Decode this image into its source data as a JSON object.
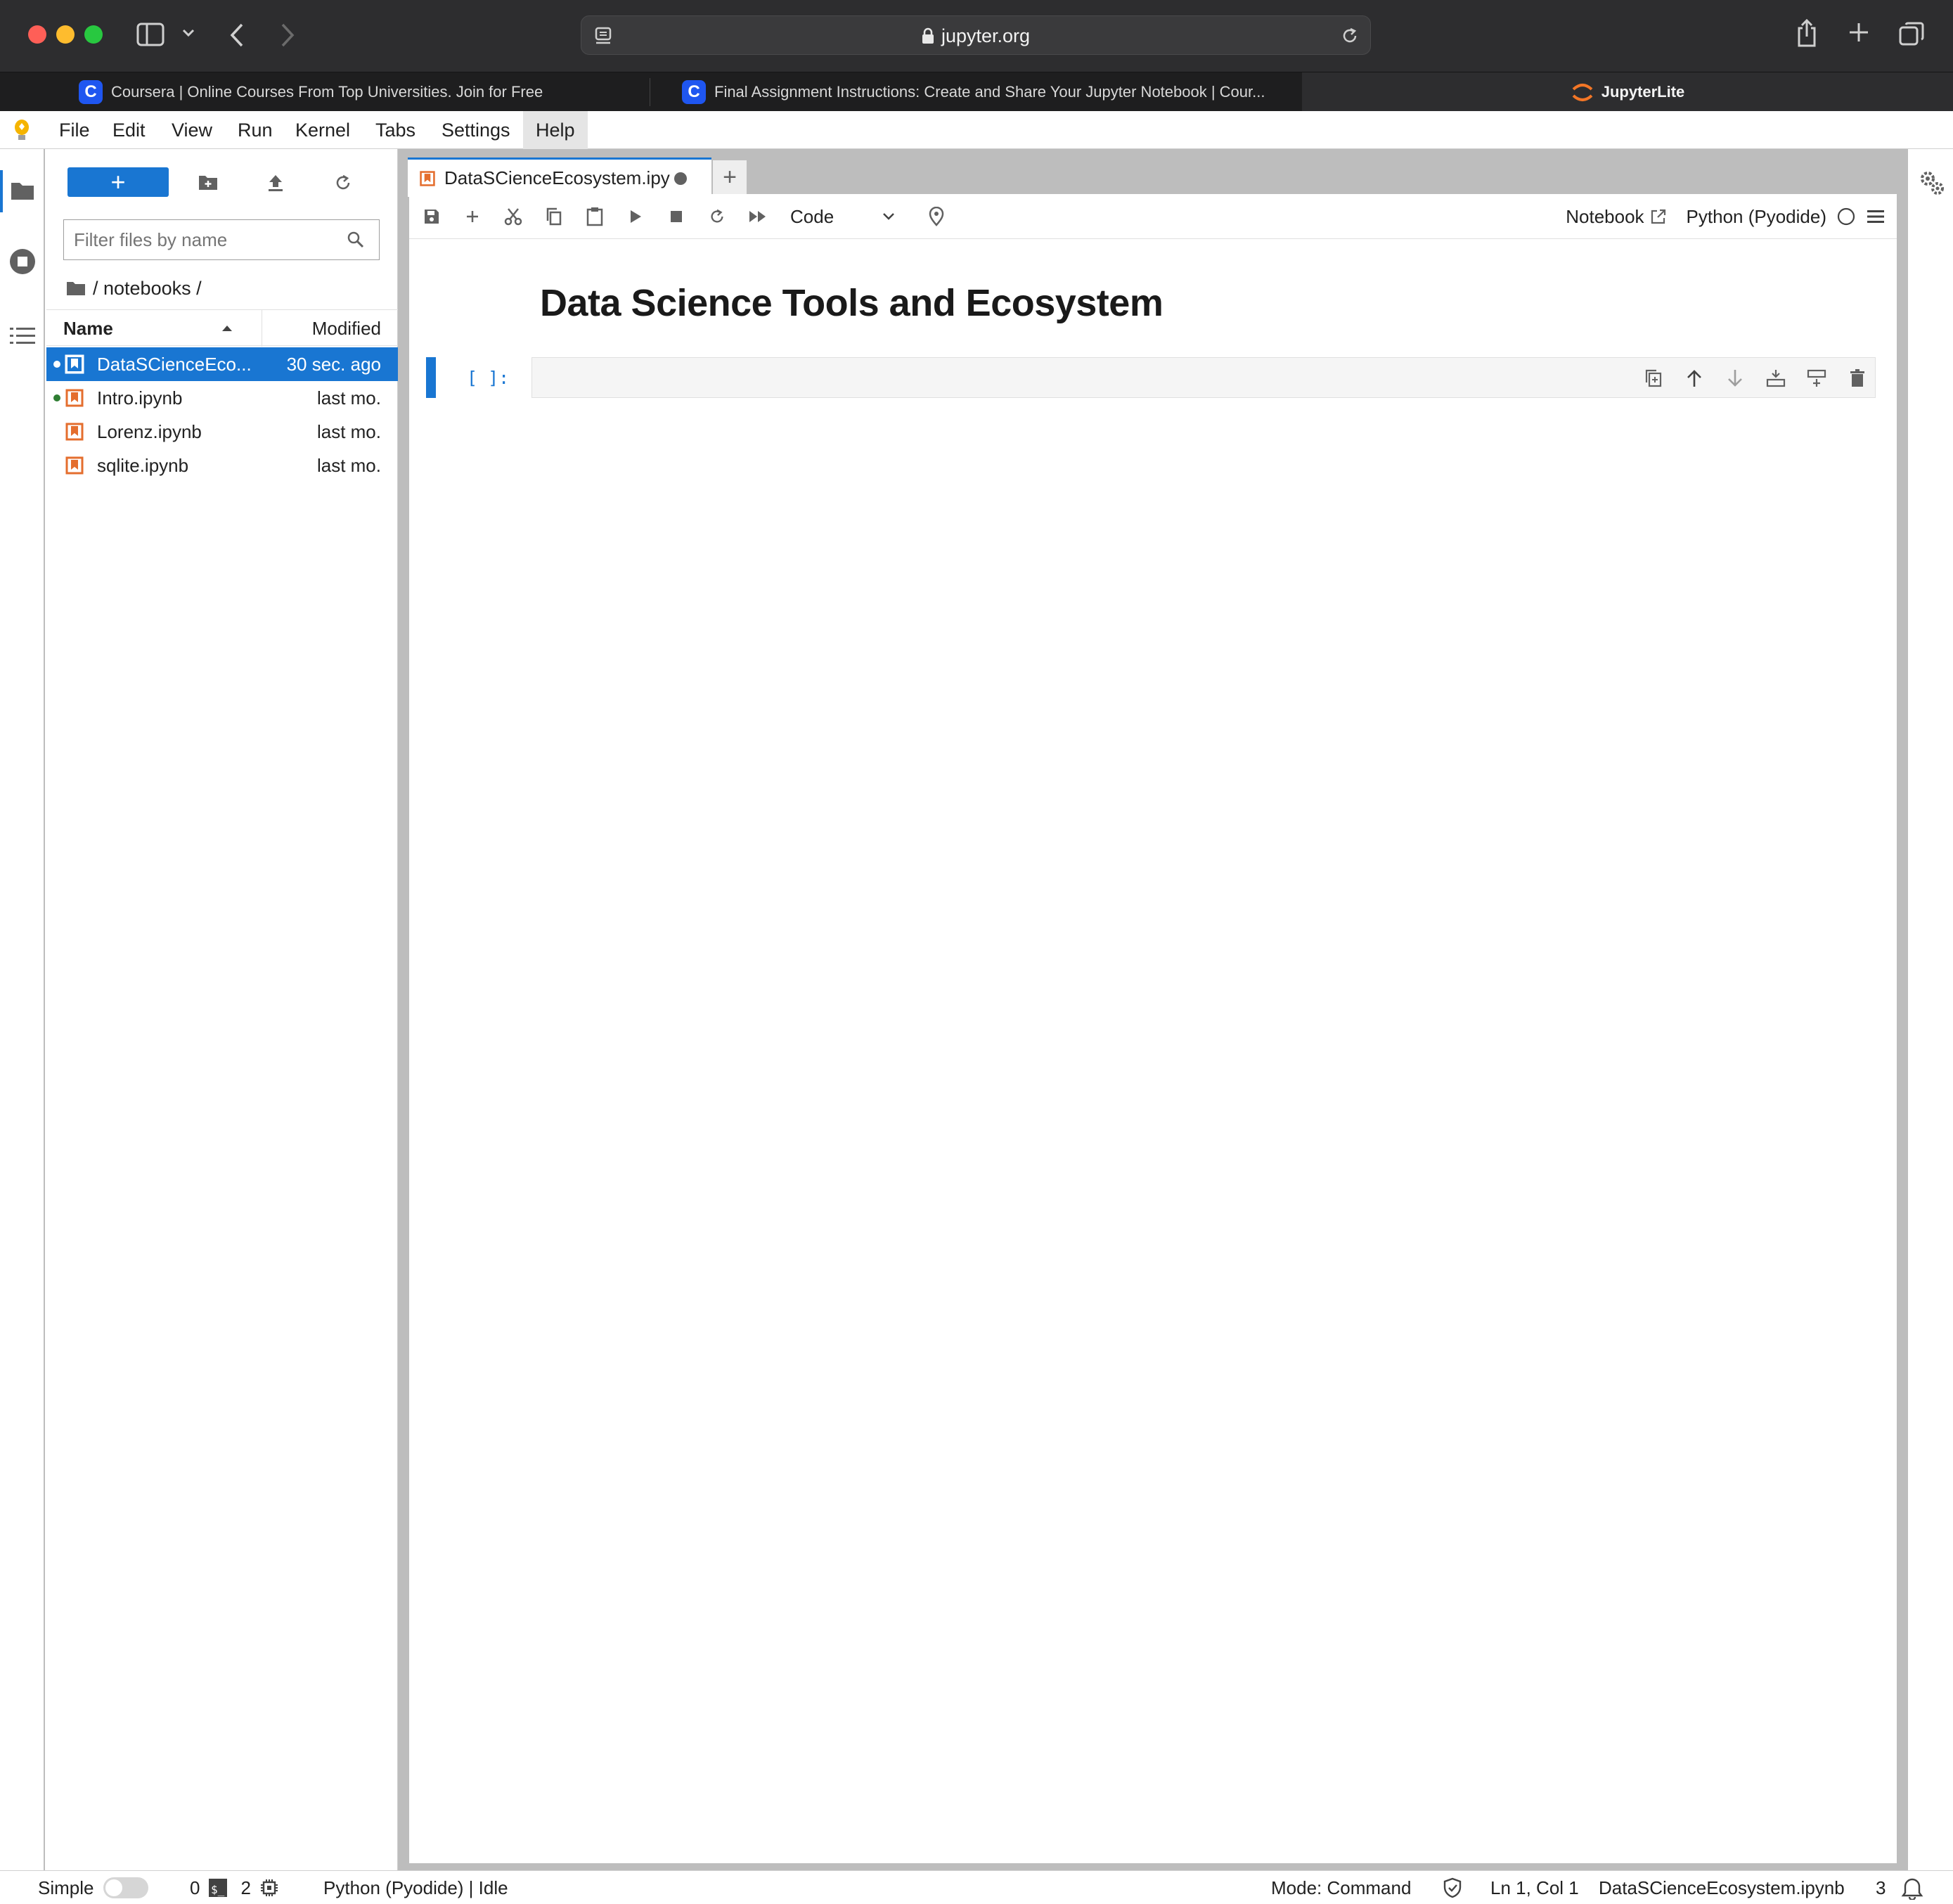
{
  "browser": {
    "url": "jupyter.org",
    "tabs": [
      {
        "label": "Coursera | Online Courses From Top Universities. Join for Free"
      },
      {
        "label": "Final Assignment Instructions: Create and Share Your Jupyter Notebook | Cour..."
      },
      {
        "label": "JupyterLite"
      }
    ]
  },
  "menubar": {
    "items": [
      "File",
      "Edit",
      "View",
      "Run",
      "Kernel",
      "Tabs",
      "Settings",
      "Help"
    ],
    "active": "Help"
  },
  "filebrowser": {
    "new_label": "+",
    "filter_placeholder": "Filter files by name",
    "breadcrumb": "/ notebooks /",
    "col_name": "Name",
    "col_modified": "Modified",
    "files": [
      {
        "name": "DataSCienceEco...",
        "modified": "30 sec. ago",
        "selected": true,
        "running": true
      },
      {
        "name": "Intro.ipynb",
        "modified": "last mo.",
        "selected": false,
        "running": true
      },
      {
        "name": "Lorenz.ipynb",
        "modified": "last mo.",
        "selected": false,
        "running": false
      },
      {
        "name": "sqlite.ipynb",
        "modified": "last mo.",
        "selected": false,
        "running": false
      }
    ]
  },
  "notebook": {
    "tab_label": "DataSCienceEcosystem.ipy",
    "new_tab": "+",
    "cell_type": "Code",
    "open_in": "Notebook",
    "kernel": "Python (Pyodide)",
    "heading": "Data Science Tools and Ecosystem",
    "cell_prompt": "[ ]:"
  },
  "statusbar": {
    "mode_label": "Simple",
    "terminals": "0",
    "kernels": "2",
    "kernel_status": "Python (Pyodide) | Idle",
    "mode": "Mode: Command",
    "position": "Ln 1, Col 1",
    "filename": "DataSCienceEcosystem.ipynb",
    "notifications": "3"
  },
  "colors": {
    "accent": "#1976d2",
    "chrome_bg": "#2d2d2f",
    "notebook_icon": "#e46e2e",
    "running_dot": "#2e7d32"
  }
}
